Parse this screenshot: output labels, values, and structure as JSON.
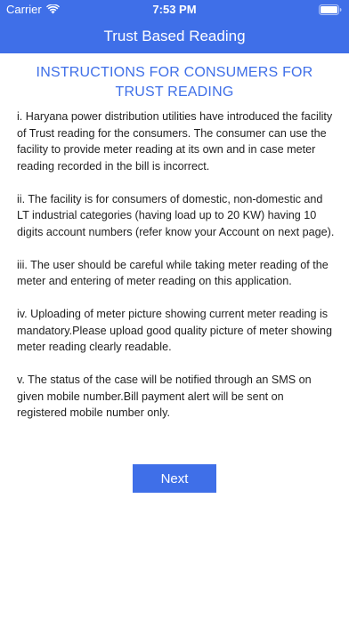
{
  "status_bar": {
    "carrier": "Carrier",
    "time": "7:53 PM"
  },
  "header": {
    "title": "Trust Based Reading",
    "background_color": "#3f6fe8"
  },
  "instructions": {
    "heading_line1": "INSTRUCTIONS FOR CONSUMERS FOR",
    "heading_line2": "TRUST READING",
    "paragraphs": [
      "i. Haryana power distribution utilities have introduced the facility of Trust reading for the consumers. The consumer can use the facility to provide meter reading at its own and in case meter reading recorded in the bill is incorrect.",
      "ii. The facility is for consumers of domestic, non-domestic and LT industrial categories (having load up to 20 KW) having 10 digits account numbers (refer know your Account on next page).",
      "iii. The user should be careful while taking meter reading of the meter and entering of meter reading on this application.",
      "iv. Uploading of meter picture showing current meter reading is mandatory.Please upload good quality picture of meter showing meter reading clearly readable.",
      "v. The status of the case will be notified through an SMS on given mobile number.Bill payment alert will be sent on registered mobile number only."
    ]
  },
  "next_button": {
    "label": "Next"
  },
  "icons": [
    "wifi-icon",
    "battery-icon"
  ]
}
